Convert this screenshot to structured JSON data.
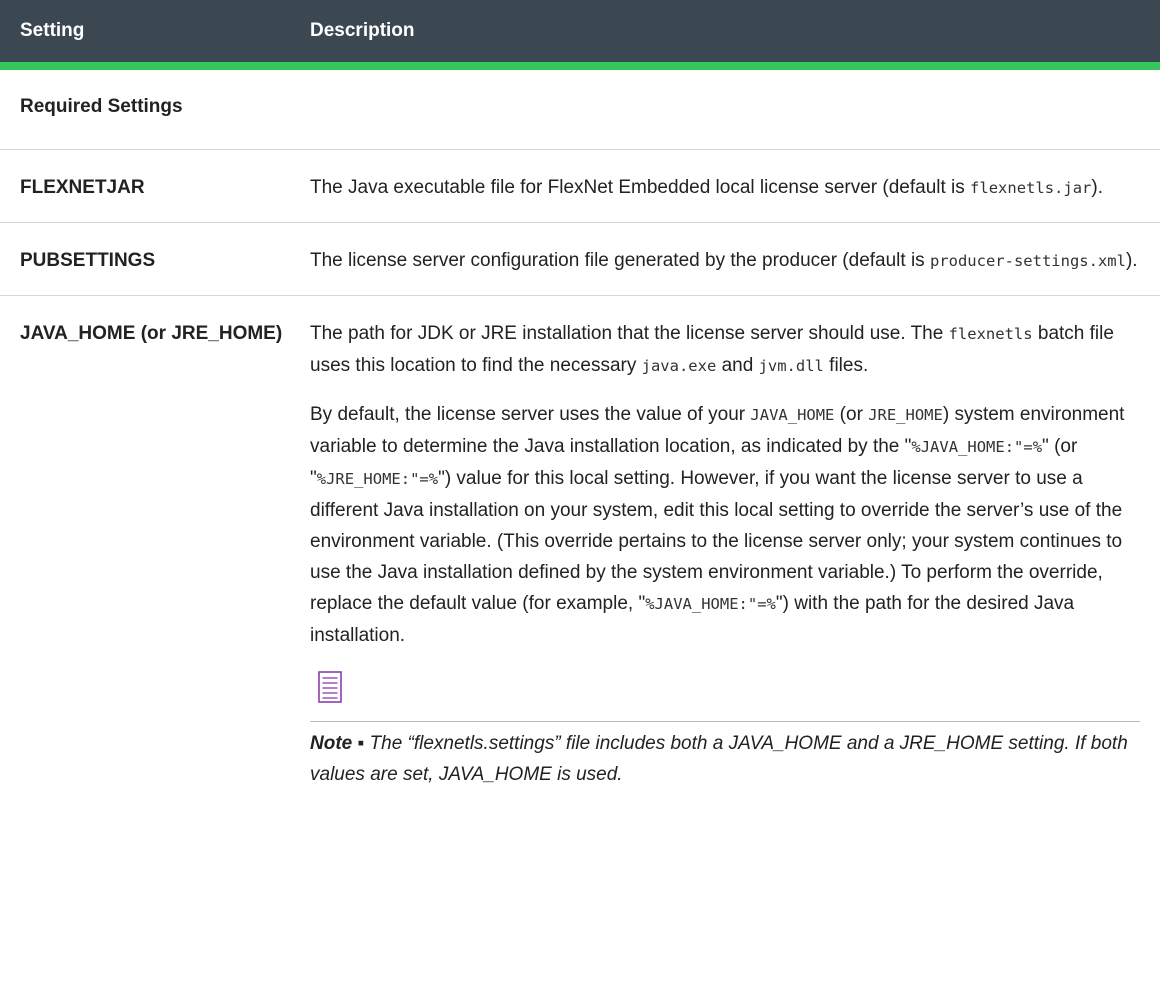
{
  "table": {
    "headers": {
      "setting": "Setting",
      "description": "Description"
    },
    "section_title": "Required Settings",
    "rows": [
      {
        "setting": "FLEXNETJAR",
        "desc_part1": "The Java executable file for FlexNet Embedded local license server (default is ",
        "desc_code1": "flexnetls.jar",
        "desc_part2": ")."
      },
      {
        "setting": "PUBSETTINGS",
        "desc_part1": "The license server configuration file generated by the producer (default is ",
        "desc_code1": "producer-settings.xml",
        "desc_part2": ")."
      },
      {
        "setting": "JAVA_HOME (or JRE_HOME)",
        "p1_text1": "The path for JDK or JRE installation that the license server should use. The ",
        "p1_code1": "flexnetls",
        "p1_text2": " batch file uses this location to find the necessary ",
        "p1_code2": "java.exe",
        "p1_text3": " and ",
        "p1_code3": "jvm.dll",
        "p1_text4": " files.",
        "p2_text1": "By default, the license server uses the value of your ",
        "p2_code1": "JAVA_HOME",
        "p2_text2": " (or ",
        "p2_code2": "JRE_HOME",
        "p2_text3": ") system environment variable to determine the Java installation location, as indicated by the \"",
        "p2_code3": "%JAVA_HOME:\"=%",
        "p2_text4": "\" (or \"",
        "p2_code4": "%JRE_HOME:\"=%",
        "p2_text5": "\") value for this local setting. However, if you want the license server to use a different Java installation on your system, edit this local setting to override the server’s use of the environment variable. (This override pertains to the license server only; your system continues to use the Java installation defined by the system environment variable.) To perform the override, replace the default value (for example, \"",
        "p2_code5": "%JAVA_HOME:\"=%",
        "p2_text6": "\") with the path for the desired Java installation.",
        "note_label": "Note ▪ ",
        "note_text": "The “flexnetls.settings” file includes both a JAVA_HOME and a JRE_HOME setting. If both values are set, JAVA_HOME is used."
      }
    ]
  },
  "colors": {
    "header_bg": "#3c4851",
    "header_accent": "#34c759",
    "note_icon": "#8b3fa8"
  },
  "icons": {
    "note": "note-icon"
  }
}
